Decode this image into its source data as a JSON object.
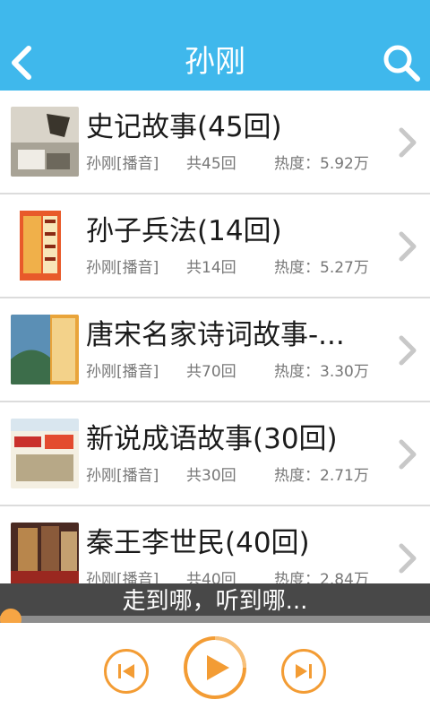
{
  "header": {
    "title": "孙刚",
    "back_icon": "chevron-left-icon",
    "search_icon": "search-icon",
    "background": "#3fb8ec"
  },
  "albums": [
    {
      "title": "史记故事(45回)",
      "narrator": "孙刚[播音]",
      "episodes": "共45回",
      "popularity": "热度：5.92万"
    },
    {
      "title": "孙子兵法(14回)",
      "narrator": "孙刚[播音]",
      "episodes": "共14回",
      "popularity": "热度：5.27万"
    },
    {
      "title": "唐宋名家诗词故事-...",
      "narrator": "孙刚[播音]",
      "episodes": "共70回",
      "popularity": "热度：3.30万"
    },
    {
      "title": "新说成语故事(30回)",
      "narrator": "孙刚[播音]",
      "episodes": "共30回",
      "popularity": "热度：2.71万"
    },
    {
      "title": "秦王李世民(40回)",
      "narrator": "孙刚[播音]",
      "episodes": "共40回",
      "popularity": "热度：2.84万"
    }
  ],
  "player": {
    "now_playing_text": "走到哪，听到哪...",
    "progress": 0.0,
    "accent": "#f39c34",
    "prev_icon": "skip-previous-icon",
    "play_icon": "play-icon",
    "next_icon": "skip-next-icon"
  }
}
